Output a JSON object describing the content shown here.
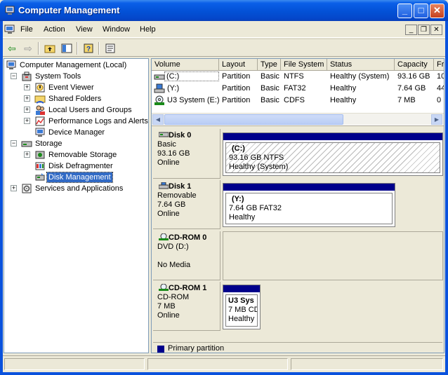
{
  "window": {
    "title": "Computer Management"
  },
  "menubar": {
    "items": [
      "File",
      "Action",
      "View",
      "Window",
      "Help"
    ]
  },
  "tree": {
    "items": [
      {
        "label": "Computer Management (Local)",
        "icon": "computer-icon"
      },
      {
        "label": "System Tools",
        "icon": "tools-icon"
      },
      {
        "label": "Event Viewer",
        "icon": "event-viewer-icon"
      },
      {
        "label": "Shared Folders",
        "icon": "shared-folders-icon"
      },
      {
        "label": "Local Users and Groups",
        "icon": "users-icon"
      },
      {
        "label": "Performance Logs and Alerts",
        "icon": "performance-icon"
      },
      {
        "label": "Device Manager",
        "icon": "device-manager-icon"
      },
      {
        "label": "Storage",
        "icon": "storage-icon"
      },
      {
        "label": "Removable Storage",
        "icon": "removable-storage-icon"
      },
      {
        "label": "Disk Defragmenter",
        "icon": "defragmenter-icon"
      },
      {
        "label": "Disk Management",
        "icon": "disk-management-icon"
      },
      {
        "label": "Services and Applications",
        "icon": "services-icon"
      }
    ],
    "selected": "Disk Management"
  },
  "volumes": {
    "columns": [
      "Volume",
      "Layout",
      "Type",
      "File System",
      "Status",
      "Capacity",
      "Fr"
    ],
    "rows": [
      [
        "(C:)",
        "Partition",
        "Basic",
        "NTFS",
        "Healthy (System)",
        "93.16 GB",
        "10"
      ],
      [
        "(Y:)",
        "Partition",
        "Basic",
        "FAT32",
        "Healthy",
        "7.64 GB",
        "44"
      ],
      [
        "U3 System (E:)",
        "Partition",
        "Basic",
        "CDFS",
        "Healthy",
        "7 MB",
        "0"
      ]
    ]
  },
  "disks": [
    {
      "name": "Disk 0",
      "type": "Basic",
      "size": "93.16 GB",
      "state": "Online",
      "partition": {
        "name": "(C:)",
        "detail": "93.16 GB NTFS",
        "status": "Healthy (System)"
      }
    },
    {
      "name": "Disk 1",
      "type": "Removable",
      "size": "7.64 GB",
      "state": "Online",
      "partition": {
        "name": "(Y:)",
        "detail": "7.64 GB FAT32",
        "status": "Healthy"
      }
    },
    {
      "name": "CD-ROM 0",
      "type": "DVD (D:)",
      "size": "",
      "state": "No Media",
      "partition": null
    },
    {
      "name": "CD-ROM 1",
      "type": "CD-ROM",
      "size": "7 MB",
      "state": "Online",
      "partition": {
        "name": "U3 Sys",
        "detail": "7 MB CD",
        "status": "Healthy"
      }
    }
  ],
  "legend": {
    "primary_partition": "Primary partition"
  },
  "colors": {
    "primary_partition": "#00008b",
    "title_bar": "#0a52dd",
    "selection": "#316ac5"
  }
}
